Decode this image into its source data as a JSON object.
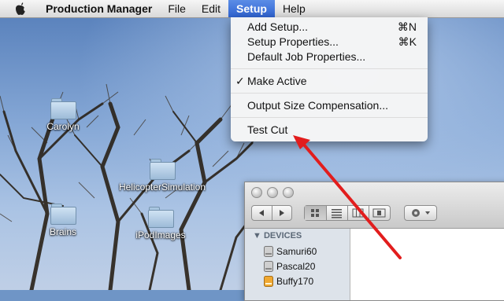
{
  "menubar": {
    "app_name": "Production Manager",
    "items": [
      {
        "label": "File"
      },
      {
        "label": "Edit"
      },
      {
        "label": "Setup"
      },
      {
        "label": "Help"
      }
    ]
  },
  "setup_menu": {
    "items": [
      {
        "label": "Add Setup...",
        "shortcut": "⌘N"
      },
      {
        "label": "Setup Properties...",
        "shortcut": "⌘K"
      },
      {
        "label": "Default Job Properties..."
      },
      {
        "label": "Make Active",
        "checked": true
      },
      {
        "label": "Output Size Compensation..."
      },
      {
        "label": "Test Cut"
      }
    ]
  },
  "desktop": {
    "icons": [
      {
        "label": "Carolyn"
      },
      {
        "label": "HelicopterSimulation"
      },
      {
        "label": "Brains"
      },
      {
        "label": "iPodImages"
      }
    ]
  },
  "finder": {
    "sidebar_heading": "DEVICES",
    "devices": [
      {
        "label": "Samuri60"
      },
      {
        "label": "Pascal20"
      },
      {
        "label": "Buffy170"
      }
    ]
  },
  "colors": {
    "menu_highlight": "#2f63d1",
    "annotation_arrow": "#e21d1d"
  }
}
